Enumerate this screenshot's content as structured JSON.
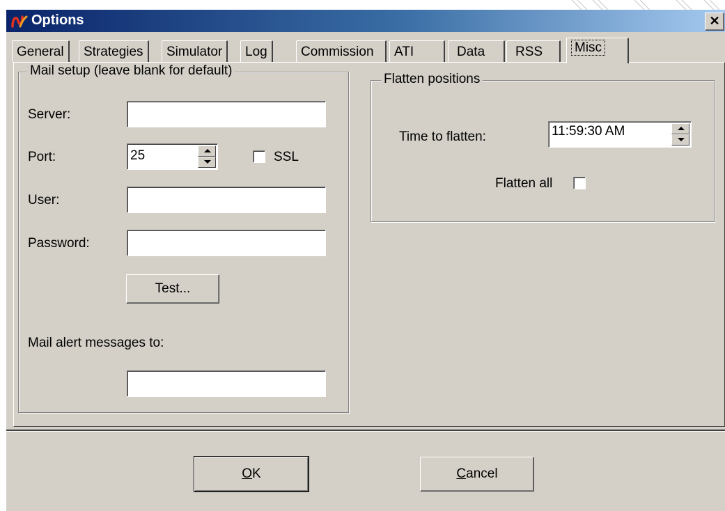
{
  "window": {
    "title": "Options"
  },
  "tabs": [
    {
      "label": "General"
    },
    {
      "label": "Strategies"
    },
    {
      "label": "Simulator"
    },
    {
      "label": "Log"
    },
    {
      "label": "Commission"
    },
    {
      "label": "ATI"
    },
    {
      "label": "Data"
    },
    {
      "label": "RSS"
    },
    {
      "label": "Misc",
      "active": true
    }
  ],
  "mail_setup": {
    "legend": "Mail setup (leave blank for default)",
    "server_label": "Server:",
    "server_value": "",
    "port_label": "Port:",
    "port_value": "25",
    "ssl_label": "SSL",
    "ssl_checked": false,
    "user_label": "User:",
    "user_value": "",
    "password_label": "Password:",
    "password_value": "",
    "test_button": "Test...",
    "mail_alert_label": "Mail alert messages to:",
    "mail_alert_value": ""
  },
  "flatten": {
    "legend": "Flatten positions",
    "time_label": "Time to flatten:",
    "time_value": "11:59:30 AM",
    "flatten_all_label": "Flatten all",
    "flatten_all_checked": false
  },
  "buttons": {
    "ok_mnemonic": "O",
    "ok_rest": "K",
    "cancel_mnemonic": "C",
    "cancel_rest": "ancel"
  },
  "colors": {
    "dialog_bg": "#d4d0c8",
    "title_start": "#0a246a",
    "title_end": "#a6caf0"
  }
}
